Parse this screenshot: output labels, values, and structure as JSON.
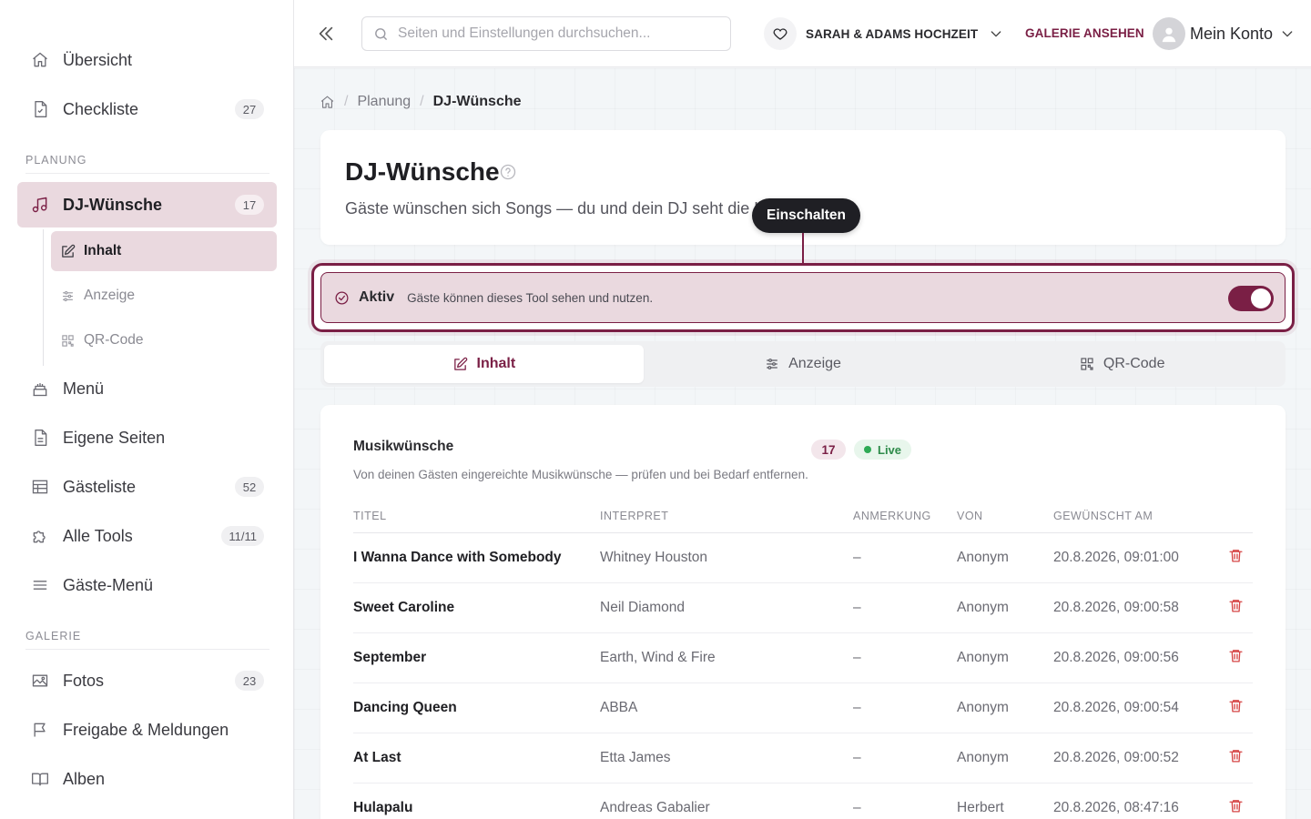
{
  "sidebar": {
    "items_top": [
      {
        "label": "Übersicht",
        "icon": "home-icon"
      },
      {
        "label": "Checkliste",
        "icon": "checklist-icon",
        "badge": "27"
      }
    ],
    "section_planung": "PLANUNG",
    "dj": {
      "label": "DJ-Wünsche",
      "badge": "17",
      "icon": "music-icon"
    },
    "sub": [
      {
        "label": "Inhalt",
        "icon": "edit-icon"
      },
      {
        "label": "Anzeige",
        "icon": "sliders-icon"
      },
      {
        "label": "QR-Code",
        "icon": "qr-code-icon"
      }
    ],
    "items_planung": [
      {
        "label": "Menü",
        "icon": "cake-icon"
      },
      {
        "label": "Eigene Seiten",
        "icon": "page-icon"
      },
      {
        "label": "Gästeliste",
        "icon": "table-icon",
        "badge": "52"
      },
      {
        "label": "Alle Tools",
        "icon": "puzzle-icon",
        "badge": "11/11"
      },
      {
        "label": "Gäste-Menü",
        "icon": "menu-icon"
      }
    ],
    "section_galerie": "GALERIE",
    "items_galerie": [
      {
        "label": "Fotos",
        "icon": "image-icon",
        "badge": "23"
      },
      {
        "label": "Freigabe & Meldungen",
        "icon": "flag-icon"
      },
      {
        "label": "Alben",
        "icon": "book-icon"
      }
    ]
  },
  "header": {
    "search_placeholder": "Seiten und Einstellungen durchsuchen...",
    "event_name": "SARAH & ADAMS HOCHZEIT",
    "gallery_link": "GALERIE ANSEHEN",
    "account_name": "Mein Konto"
  },
  "breadcrumb": {
    "items": [
      "Planung",
      "DJ-Wünsche"
    ]
  },
  "page": {
    "title": "DJ-Wünsche",
    "subtitle": "Gäste wünschen sich Songs — du und dein DJ seht die Li"
  },
  "tooltip": "Einschalten",
  "active_banner": {
    "label": "Aktiv",
    "description": "Gäste können dieses Tool sehen und nutzen.",
    "enabled": true
  },
  "tabs": [
    {
      "label": "Inhalt",
      "icon": "edit-icon",
      "active": true
    },
    {
      "label": "Anzeige",
      "icon": "sliders-icon",
      "active": false
    },
    {
      "label": "QR-Code",
      "icon": "qr-code-icon",
      "active": false
    }
  ],
  "list": {
    "title": "Musikwünsche",
    "count": "17",
    "live_label": "Live",
    "description": "Von deinen Gästen eingereichte Musikwünsche — prüfen und bei Bedarf entfernen.",
    "columns": [
      "TITEL",
      "INTERPRET",
      "ANMERKUNG",
      "VON",
      "GEWÜNSCHT AM"
    ],
    "rows": [
      {
        "title": "I Wanna Dance with Somebody",
        "artist": "Whitney Houston",
        "note": "–",
        "from": "Anonym",
        "date": "20.8.2026, 09:01:00"
      },
      {
        "title": "Sweet Caroline",
        "artist": "Neil Diamond",
        "note": "–",
        "from": "Anonym",
        "date": "20.8.2026, 09:00:58"
      },
      {
        "title": "September",
        "artist": "Earth, Wind & Fire",
        "note": "–",
        "from": "Anonym",
        "date": "20.8.2026, 09:00:56"
      },
      {
        "title": "Dancing Queen",
        "artist": "ABBA",
        "note": "–",
        "from": "Anonym",
        "date": "20.8.2026, 09:00:54"
      },
      {
        "title": "At Last",
        "artist": "Etta James",
        "note": "–",
        "from": "Anonym",
        "date": "20.8.2026, 09:00:52"
      },
      {
        "title": "Hulapalu",
        "artist": "Andreas Gabalier",
        "note": "–",
        "from": "Herbert",
        "date": "20.8.2026, 08:47:16"
      }
    ]
  },
  "colors": {
    "accent": "#7a1f45",
    "accent_soft": "#ead9df",
    "live": "#2eaa55",
    "delete": "#d64545"
  }
}
